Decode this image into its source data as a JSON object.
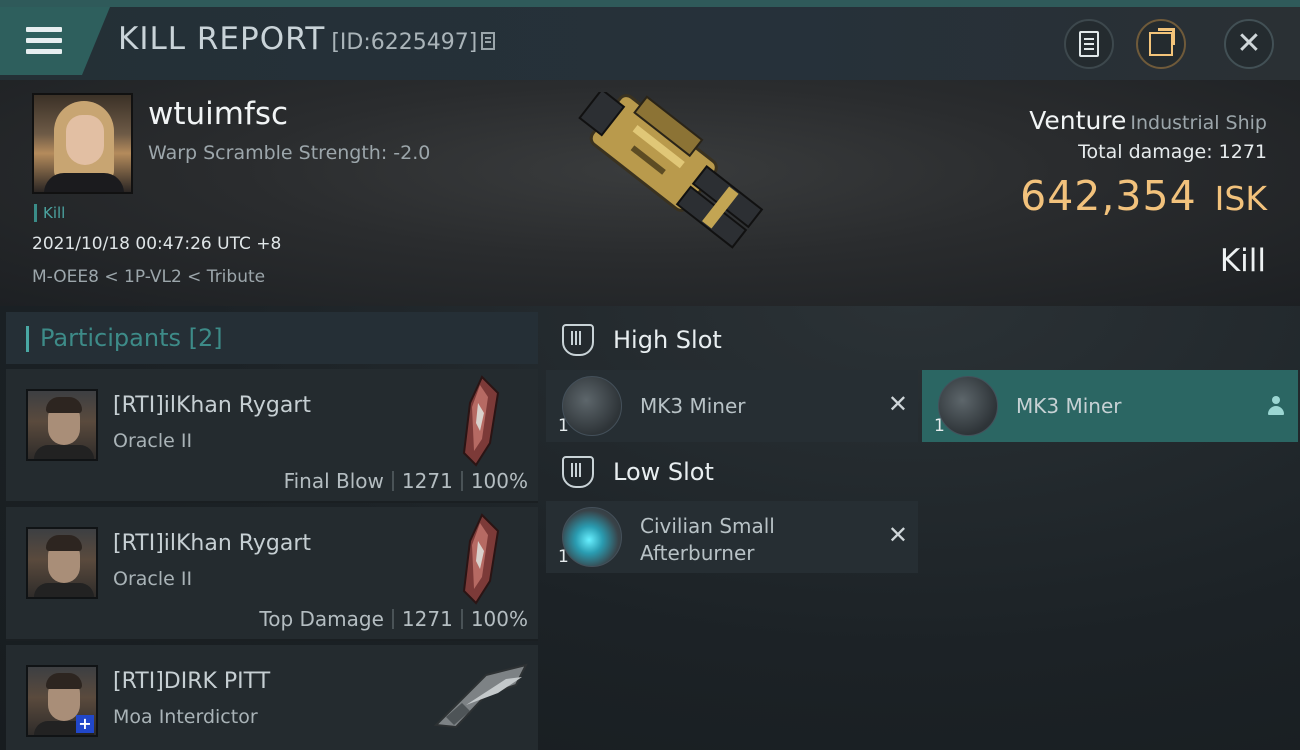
{
  "header": {
    "title": "KILL REPORT",
    "id_label": "[ID:6225497]"
  },
  "victim": {
    "name": "wtuimfsc",
    "warp_scramble": "Warp Scramble Strength: -2.0",
    "kill_tag": "Kill",
    "datetime": "2021/10/18 00:47:26 UTC +8",
    "location": "M-OEE8 < 1P-VL2 < Tribute",
    "ship_name": "Venture",
    "ship_class": "Industrial Ship",
    "total_damage_label": "Total damage:",
    "total_damage": "1271",
    "isk_value": "642,354",
    "isk_unit": "ISK",
    "result": "Kill"
  },
  "participants": {
    "title": "Participants",
    "count": "[2]",
    "items": [
      {
        "name": "[RTI]ilKhan Rygart",
        "ship": "Oracle II",
        "role": "Final Blow",
        "damage": "1271",
        "percent": "100%"
      },
      {
        "name": "[RTI]ilKhan Rygart",
        "ship": "Oracle II",
        "role": "Top Damage",
        "damage": "1271",
        "percent": "100%"
      },
      {
        "name": "[RTI]DIRK PITT",
        "ship": "Moa Interdictor"
      }
    ]
  },
  "fitting": {
    "high_slot": {
      "label": "High Slot",
      "modules": [
        {
          "name": "MK3 Miner",
          "qty": "1"
        },
        {
          "name": "MK3 Miner",
          "qty": "1"
        }
      ]
    },
    "low_slot": {
      "label": "Low Slot",
      "modules": [
        {
          "name": "Civilian Small Afterburner",
          "qty": "1"
        }
      ]
    }
  },
  "colors": {
    "accent": "#4aa8a4",
    "isk": "#f2c27c",
    "selected_module": "#2b6663"
  }
}
